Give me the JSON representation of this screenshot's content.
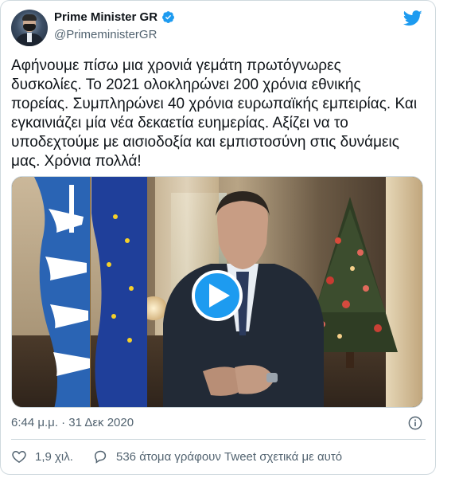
{
  "author": {
    "display_name": "Prime Minister GR",
    "handle": "@PrimeministerGR",
    "verified": true,
    "avatar_icon": "profile-photo-avatar"
  },
  "brand": {
    "icon": "twitter-bird-icon",
    "color": "#1d9bf0"
  },
  "tweet": {
    "text": "Αφήνουμε πίσω μια χρονιά γεμάτη πρωτόγνωρες\nδυσκολίες. Το 2021 ολοκληρώνει 200 χρόνια εθνικής\nπορείας. Συμπληρώνει 40 χρόνια ευρωπαϊκής εμπειρίας. Και\nεγκαινιάζει μία νέα δεκαετία ευημερίας. Αξίζει να το\nυποδεχτούμε με αισιοδοξία και εμπιστοσύνη στις δυνάμεις\nμας. Χρόνια πολλά!",
    "timestamp": "6:44 μ.μ. · 31 Δεκ 2020"
  },
  "media": {
    "type": "video",
    "play_icon": "play-icon"
  },
  "actions": {
    "likes": "1,9 χιλ.",
    "conversation": "536 άτομα γράφουν Tweet σχετικά με αυτό"
  },
  "colors": {
    "text_primary": "#0f1419",
    "text_secondary": "#536471",
    "border": "#cfd9de",
    "accent": "#1d9bf0"
  }
}
